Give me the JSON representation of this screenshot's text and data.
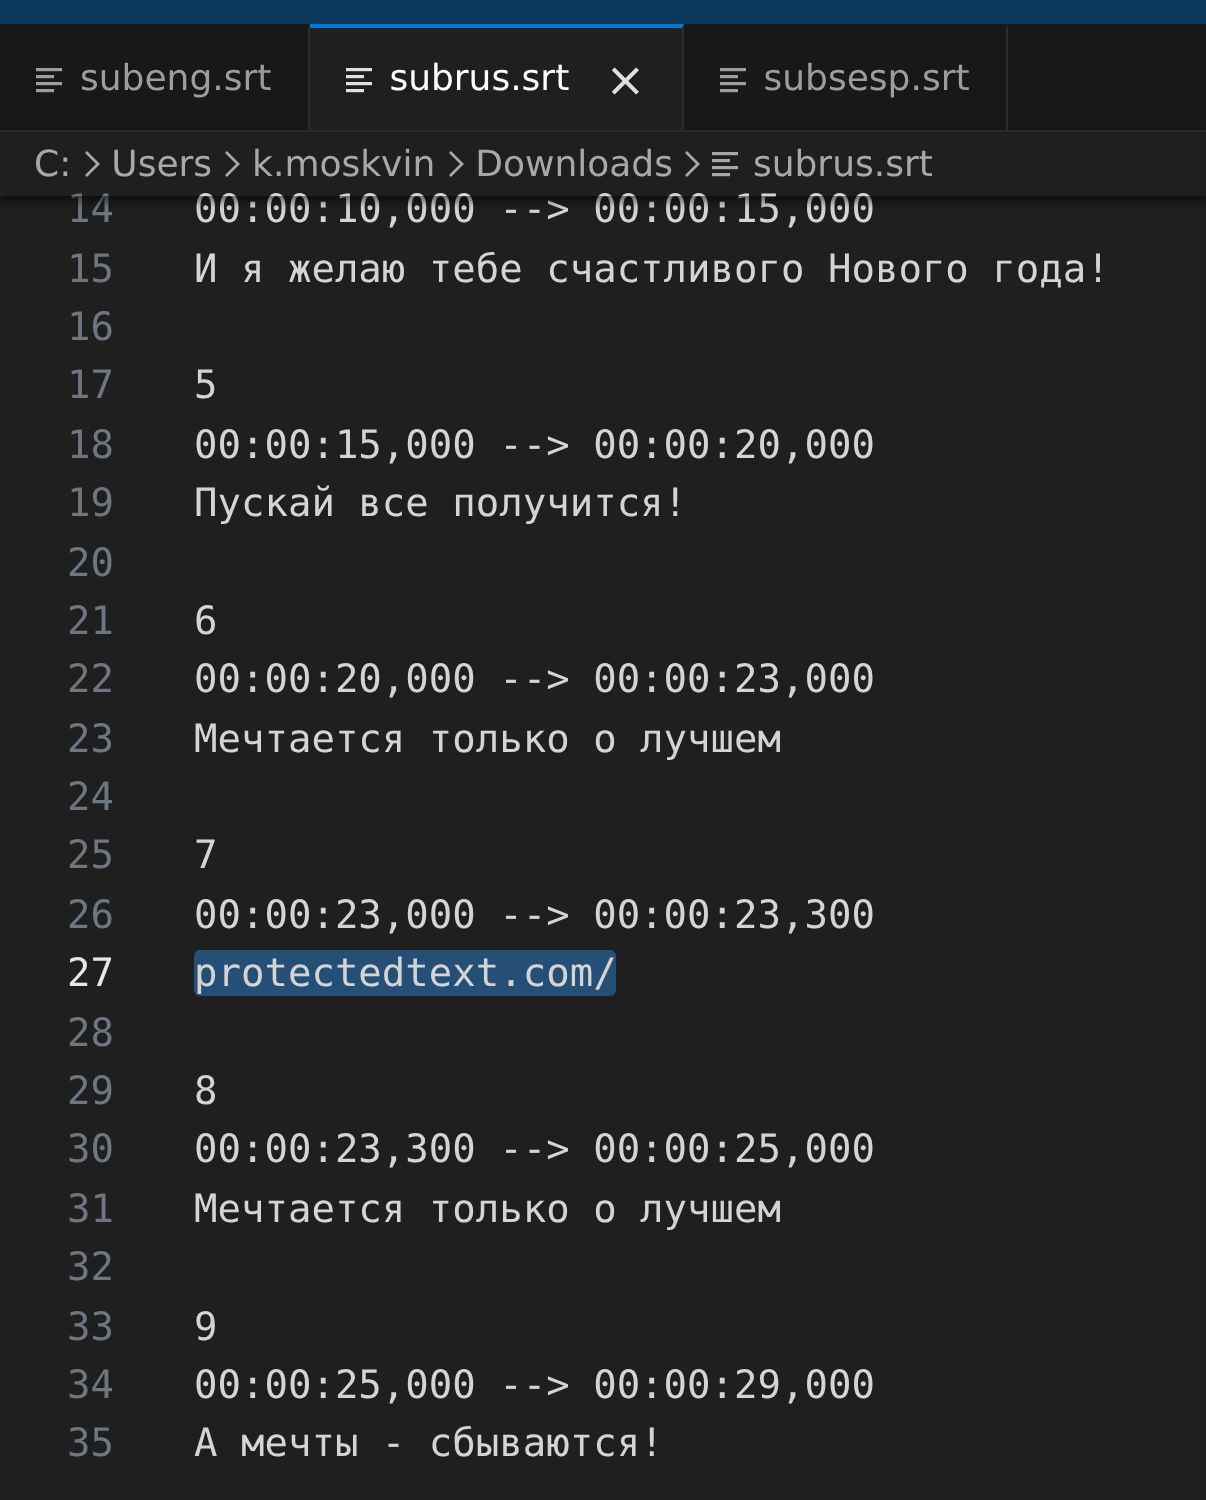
{
  "tabs": [
    {
      "label": "subeng.srt",
      "selected": false
    },
    {
      "label": "subrus.srt",
      "selected": true,
      "close": "×"
    },
    {
      "label": "subsesp.srt",
      "selected": false
    }
  ],
  "breadcrumb": [
    "C:",
    "Users",
    "k.moskvin",
    "Downloads",
    "subrus.srt"
  ],
  "lines": [
    {
      "number": "14",
      "text": "00:00:10,000 --> 00:00:15,000",
      "current": false,
      "selected": false
    },
    {
      "number": "15",
      "text": "И я желаю тебе счастливого Нового года!",
      "current": false,
      "selected": false
    },
    {
      "number": "16",
      "current": false
    },
    {
      "number": "17",
      "text": "5",
      "current": false,
      "selected": false
    },
    {
      "number": "18",
      "text": "00:00:15,000 --> 00:00:20,000",
      "current": false,
      "selected": false
    },
    {
      "number": "19",
      "text": "Пускай все получится!",
      "current": false,
      "selected": false
    },
    {
      "number": "20",
      "current": false
    },
    {
      "number": "21",
      "text": "6",
      "current": false,
      "selected": false
    },
    {
      "number": "22",
      "text": "00:00:20,000 --> 00:00:23,000",
      "current": false,
      "selected": false
    },
    {
      "number": "23",
      "text": "Мечтается только о лучшем",
      "current": false,
      "selected": false
    },
    {
      "number": "24",
      "current": false
    },
    {
      "number": "25",
      "text": "7",
      "current": false,
      "selected": false
    },
    {
      "number": "26",
      "text": "00:00:23,000 --> 00:00:23,300",
      "current": false,
      "selected": false
    },
    {
      "number": "27",
      "text": "protectedtext.com/",
      "current": true,
      "selected": true
    },
    {
      "number": "28",
      "current": false
    },
    {
      "number": "29",
      "text": "8",
      "current": false,
      "selected": false
    },
    {
      "number": "30",
      "text": "00:00:23,300 --> 00:00:25,000",
      "current": false,
      "selected": false
    },
    {
      "number": "31",
      "text": "Мечтается только о лучшем",
      "current": false,
      "selected": false
    },
    {
      "number": "32",
      "current": false
    },
    {
      "number": "33",
      "text": "9",
      "current": false,
      "selected": false
    },
    {
      "number": "34",
      "text": "00:00:25,000 --> 00:00:29,000",
      "current": false,
      "selected": false
    },
    {
      "number": "35",
      "text": "А мечты - сбываются!",
      "current": false,
      "selected": false
    }
  ]
}
